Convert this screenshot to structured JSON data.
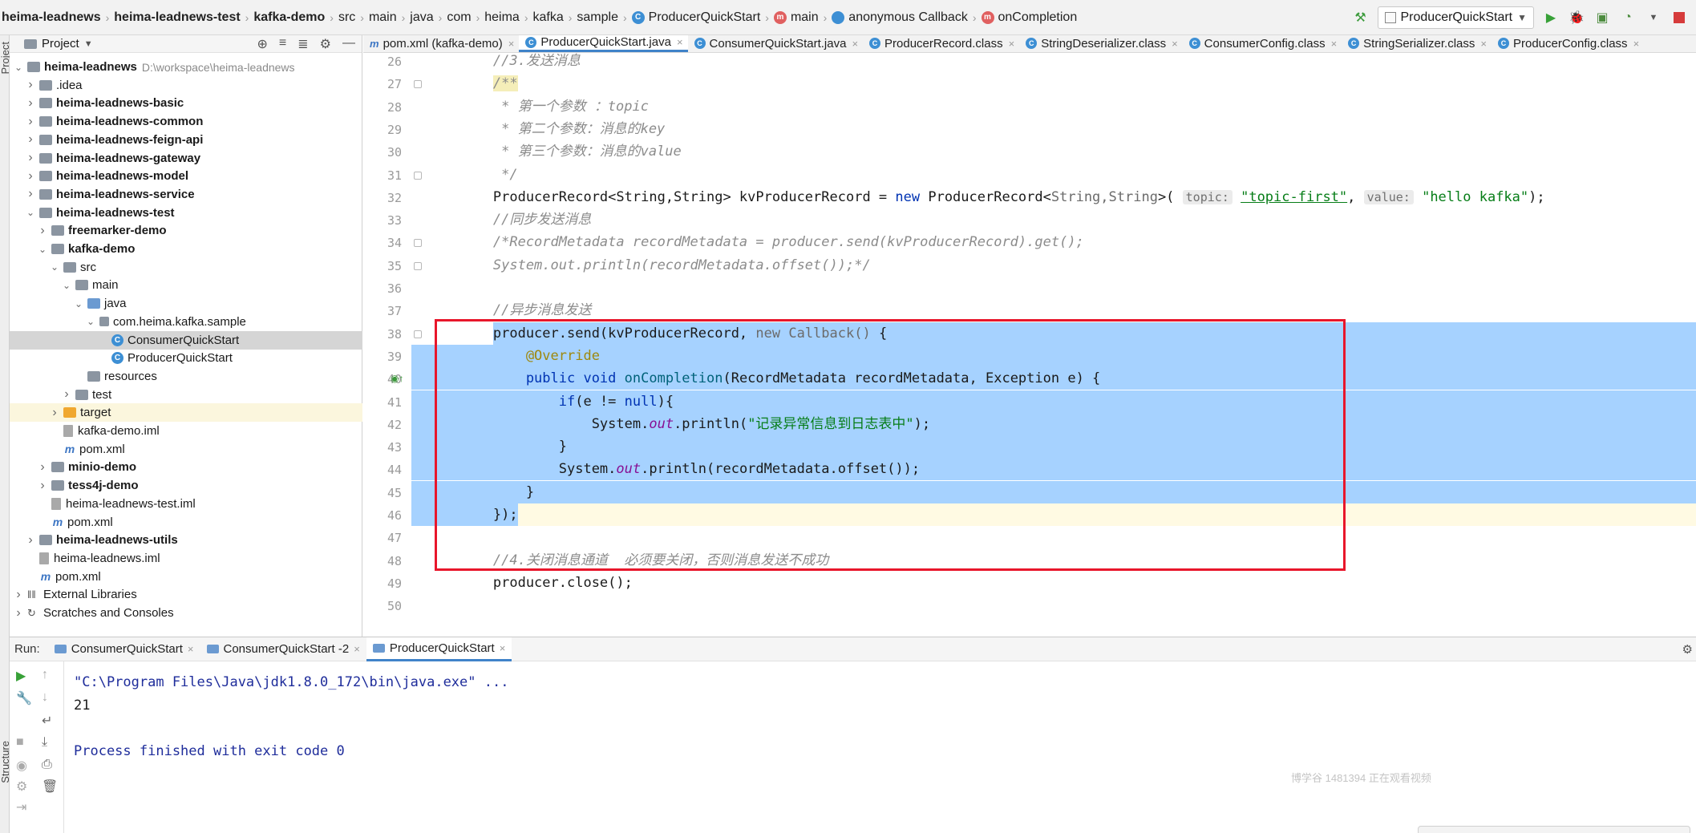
{
  "breadcrumb": {
    "items": [
      {
        "label": "heima-leadnews",
        "bold": true,
        "icon": ""
      },
      {
        "label": "heima-leadnews-test",
        "bold": true,
        "icon": ""
      },
      {
        "label": "kafka-demo",
        "bold": true,
        "icon": ""
      },
      {
        "label": "src",
        "bold": false,
        "icon": ""
      },
      {
        "label": "main",
        "bold": false,
        "icon": ""
      },
      {
        "label": "java",
        "bold": false,
        "icon": ""
      },
      {
        "label": "com",
        "bold": false,
        "icon": ""
      },
      {
        "label": "heima",
        "bold": false,
        "icon": ""
      },
      {
        "label": "kafka",
        "bold": false,
        "icon": ""
      },
      {
        "label": "sample",
        "bold": false,
        "icon": ""
      },
      {
        "label": "ProducerQuickStart",
        "bold": false,
        "icon": "class-icon"
      },
      {
        "label": "main",
        "bold": false,
        "icon": "method-icon"
      },
      {
        "label": "anonymous Callback",
        "bold": false,
        "icon": "anonymous-class-icon"
      },
      {
        "label": "onCompletion",
        "bold": false,
        "icon": "method-icon"
      }
    ]
  },
  "toolbar": {
    "run_config": "ProducerQuickStart"
  },
  "project": {
    "title": "Project",
    "tree": [
      {
        "label": "heima-leadnews",
        "path": "D:\\workspace\\heima-leadnews",
        "level": 0,
        "arrow": "open",
        "icon": "module",
        "bold": true
      },
      {
        "label": ".idea",
        "level": 1,
        "arrow": "closed",
        "icon": "folder",
        "bold": false
      },
      {
        "label": "heima-leadnews-basic",
        "level": 1,
        "arrow": "closed",
        "icon": "module",
        "bold": true
      },
      {
        "label": "heima-leadnews-common",
        "level": 1,
        "arrow": "closed",
        "icon": "module",
        "bold": true
      },
      {
        "label": "heima-leadnews-feign-api",
        "level": 1,
        "arrow": "closed",
        "icon": "module",
        "bold": true
      },
      {
        "label": "heima-leadnews-gateway",
        "level": 1,
        "arrow": "closed",
        "icon": "module",
        "bold": true
      },
      {
        "label": "heima-leadnews-model",
        "level": 1,
        "arrow": "closed",
        "icon": "module",
        "bold": true
      },
      {
        "label": "heima-leadnews-service",
        "level": 1,
        "arrow": "closed",
        "icon": "module",
        "bold": true
      },
      {
        "label": "heima-leadnews-test",
        "level": 1,
        "arrow": "open",
        "icon": "module",
        "bold": true
      },
      {
        "label": "freemarker-demo",
        "level": 2,
        "arrow": "closed",
        "icon": "module",
        "bold": true
      },
      {
        "label": "kafka-demo",
        "level": 2,
        "arrow": "open",
        "icon": "module",
        "bold": true
      },
      {
        "label": "src",
        "level": 3,
        "arrow": "open",
        "icon": "folder",
        "bold": false
      },
      {
        "label": "main",
        "level": 4,
        "arrow": "open",
        "icon": "folder",
        "bold": false
      },
      {
        "label": "java",
        "level": 5,
        "arrow": "open",
        "icon": "source-folder",
        "bold": false
      },
      {
        "label": "com.heima.kafka.sample",
        "level": 6,
        "arrow": "open",
        "icon": "package",
        "bold": false
      },
      {
        "label": "ConsumerQuickStart",
        "level": 7,
        "arrow": "none",
        "icon": "class",
        "bold": false,
        "selected": true
      },
      {
        "label": "ProducerQuickStart",
        "level": 7,
        "arrow": "none",
        "icon": "class",
        "bold": false
      },
      {
        "label": "resources",
        "level": 5,
        "arrow": "none",
        "icon": "folder",
        "bold": false
      },
      {
        "label": "test",
        "level": 4,
        "arrow": "closed",
        "icon": "folder",
        "bold": false
      },
      {
        "label": "target",
        "level": 3,
        "arrow": "closed",
        "icon": "excluded-folder",
        "bold": false,
        "excluded": true
      },
      {
        "label": "kafka-demo.iml",
        "level": 3,
        "arrow": "none",
        "icon": "iml",
        "bold": false
      },
      {
        "label": "pom.xml",
        "level": 3,
        "arrow": "none",
        "icon": "maven",
        "bold": false
      },
      {
        "label": "minio-demo",
        "level": 2,
        "arrow": "closed",
        "icon": "module",
        "bold": true
      },
      {
        "label": "tess4j-demo",
        "level": 2,
        "arrow": "closed",
        "icon": "module",
        "bold": true
      },
      {
        "label": "heima-leadnews-test.iml",
        "level": 2,
        "arrow": "none",
        "icon": "iml",
        "bold": false
      },
      {
        "label": "pom.xml",
        "level": 2,
        "arrow": "none",
        "icon": "maven",
        "bold": false
      },
      {
        "label": "heima-leadnews-utils",
        "level": 1,
        "arrow": "closed",
        "icon": "module",
        "bold": true
      },
      {
        "label": "heima-leadnews.iml",
        "level": 1,
        "arrow": "none",
        "icon": "iml",
        "bold": false
      },
      {
        "label": "pom.xml",
        "level": 1,
        "arrow": "none",
        "icon": "maven",
        "bold": false
      },
      {
        "label": "External Libraries",
        "level": 0,
        "arrow": "closed",
        "icon": "libraries",
        "bold": false
      },
      {
        "label": "Scratches and Consoles",
        "level": 0,
        "arrow": "closed",
        "icon": "scratches",
        "bold": false
      }
    ]
  },
  "editor_tabs": [
    {
      "label": "pom.xml (kafka-demo)",
      "icon": "maven",
      "active": false
    },
    {
      "label": "ProducerQuickStart.java",
      "icon": "class",
      "active": true
    },
    {
      "label": "ConsumerQuickStart.java",
      "icon": "class",
      "active": false
    },
    {
      "label": "ProducerRecord.class",
      "icon": "class",
      "active": false
    },
    {
      "label": "StringDeserializer.class",
      "icon": "class",
      "active": false
    },
    {
      "label": "ConsumerConfig.class",
      "icon": "class",
      "active": false
    },
    {
      "label": "StringSerializer.class",
      "icon": "class",
      "active": false
    },
    {
      "label": "ProducerConfig.class",
      "icon": "class",
      "active": false
    }
  ],
  "code": {
    "first_line_number": 26,
    "lines": [
      {
        "n": 26,
        "tokens": [
          [
            "cm",
            "        //3.发送消息"
          ]
        ]
      },
      {
        "n": 27,
        "tokens": [
          [
            "cm",
            "        "
          ],
          [
            "cm todo",
            "/**"
          ]
        ]
      },
      {
        "n": 28,
        "tokens": [
          [
            "cm",
            "         * 第一个参数 ：topic"
          ]
        ]
      },
      {
        "n": 29,
        "tokens": [
          [
            "cm",
            "         * 第二个参数：消息的key"
          ]
        ]
      },
      {
        "n": 30,
        "tokens": [
          [
            "cm",
            "         * 第三个参数：消息的value"
          ]
        ]
      },
      {
        "n": 31,
        "tokens": [
          [
            "cm",
            "         */"
          ]
        ]
      },
      {
        "n": 32,
        "tokens": [
          [
            "",
            "        ProducerRecord<String,String> kvProducerRecord = "
          ],
          [
            "kw",
            "new "
          ],
          [
            "",
            "ProducerRecord<"
          ],
          [
            "typeparam",
            "String,String"
          ],
          [
            "",
            ">( "
          ],
          [
            "hint",
            "topic:"
          ],
          [
            "",
            " "
          ],
          [
            "str uline",
            "\"topic-first\""
          ],
          [
            "",
            ", "
          ],
          [
            "hint",
            "value:"
          ],
          [
            "",
            " "
          ],
          [
            "str",
            "\"hello kafka\""
          ],
          [
            "",
            ");"
          ]
        ]
      },
      {
        "n": 33,
        "tokens": [
          [
            "cm",
            "        //同步发送消息"
          ]
        ]
      },
      {
        "n": 34,
        "tokens": [
          [
            "cm",
            "        /*RecordMetadata recordMetadata = producer.send(kvProducerRecord).get();"
          ]
        ]
      },
      {
        "n": 35,
        "tokens": [
          [
            "cm",
            "        System.out.println(recordMetadata.offset());*/"
          ]
        ]
      },
      {
        "n": 36,
        "tokens": [
          [
            "",
            ""
          ]
        ]
      },
      {
        "n": 37,
        "tokens": [
          [
            "cm",
            "        //异步消息发送"
          ]
        ]
      },
      {
        "n": 38,
        "tokens": [
          [
            "",
            "        producer.send(kvProducerRecord, "
          ],
          [
            "typeparam",
            "new Callback() "
          ],
          [
            "",
            "{"
          ]
        ]
      },
      {
        "n": 39,
        "tokens": [
          [
            "ann",
            "            @Override"
          ]
        ]
      },
      {
        "n": 40,
        "tokens": [
          [
            "kw",
            "            public void "
          ],
          [
            "fn",
            "onCompletion"
          ],
          [
            "",
            "(RecordMetadata recordMetadata, Exception e) {"
          ]
        ]
      },
      {
        "n": 41,
        "tokens": [
          [
            "kw",
            "                if"
          ],
          [
            "",
            "(e != "
          ],
          [
            "kw",
            "null"
          ],
          [
            "",
            "){"
          ]
        ]
      },
      {
        "n": 42,
        "tokens": [
          [
            "",
            "                    System."
          ],
          [
            "sf",
            "out"
          ],
          [
            "",
            ".println("
          ],
          [
            "str",
            "\"记录异常信息到日志表中\""
          ],
          [
            "",
            ");"
          ]
        ]
      },
      {
        "n": 43,
        "tokens": [
          [
            "",
            "                }"
          ]
        ]
      },
      {
        "n": 44,
        "tokens": [
          [
            "",
            "                System."
          ],
          [
            "sf",
            "out"
          ],
          [
            "",
            ".println(recordMetadata.offset());"
          ]
        ]
      },
      {
        "n": 45,
        "tokens": [
          [
            "",
            "            }"
          ]
        ]
      },
      {
        "n": 46,
        "tokens": [
          [
            "",
            "        });"
          ]
        ]
      },
      {
        "n": 47,
        "tokens": [
          [
            "",
            ""
          ]
        ]
      },
      {
        "n": 48,
        "tokens": [
          [
            "cm",
            "        //4.关闭消息通道  必须要关闭，否则消息发送不成功"
          ]
        ]
      },
      {
        "n": 49,
        "tokens": [
          [
            "",
            "        producer.close();"
          ]
        ]
      },
      {
        "n": 50,
        "tokens": [
          [
            "",
            ""
          ]
        ]
      }
    ]
  },
  "run": {
    "label": "Run:",
    "tabs": [
      {
        "label": "ConsumerQuickStart",
        "active": false
      },
      {
        "label": "ConsumerQuickStart -2",
        "active": false
      },
      {
        "label": "ProducerQuickStart",
        "active": true
      }
    ],
    "console": [
      {
        "kind": "cmd",
        "text": "\"C:\\Program Files\\Java\\jdk1.8.0_172\\bin\\java.exe\" ..."
      },
      {
        "kind": "out",
        "text": "21"
      },
      {
        "kind": "out",
        "text": ""
      },
      {
        "kind": "exit",
        "text": "Process finished with exit code 0"
      }
    ]
  },
  "side_labels": {
    "project": "Project",
    "structure": "Structure"
  },
  "watermark": "博学谷 1481394 正在观看视频",
  "colors": {
    "selection": "#a6d2ff",
    "highlight_box": "#e8162b",
    "keyword": "#0033b3",
    "string": "#067d17",
    "comment": "#8c8c8c"
  }
}
